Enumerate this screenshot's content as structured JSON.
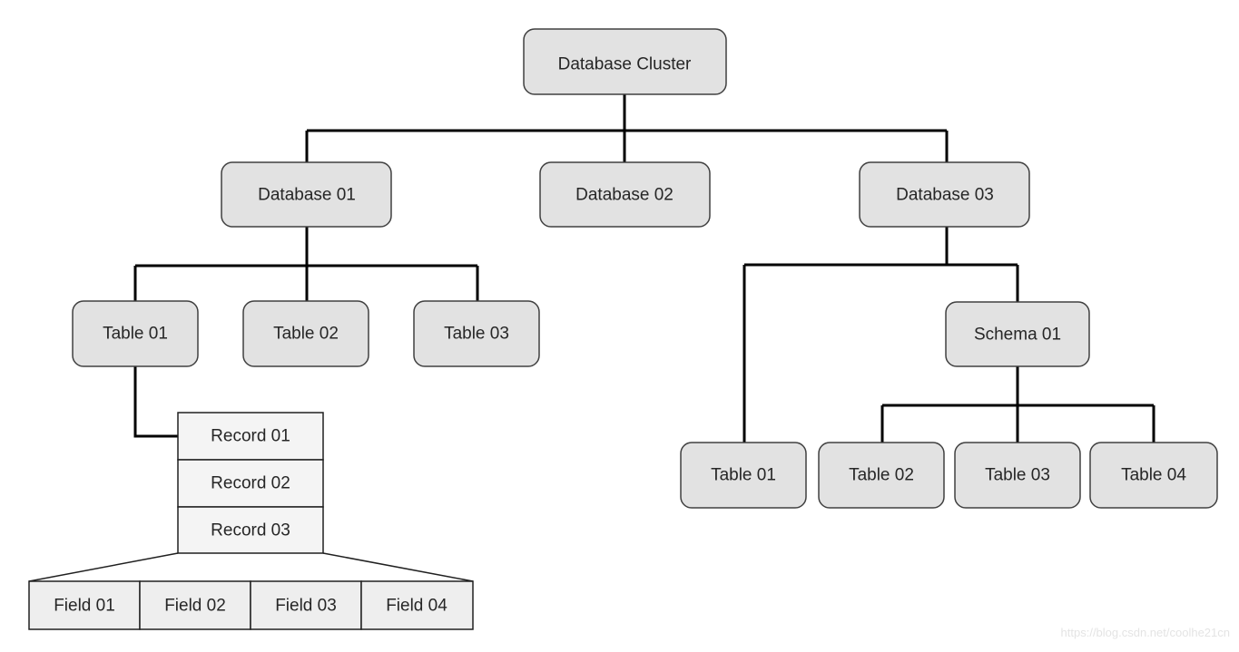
{
  "diagram": {
    "root": "Database Cluster",
    "databases": [
      "Database 01",
      "Database 02",
      "Database 03"
    ],
    "db01_tables": [
      "Table 01",
      "Table 02",
      "Table 03"
    ],
    "records": [
      "Record 01",
      "Record 02",
      "Record 03"
    ],
    "fields": [
      "Field 01",
      "Field 02",
      "Field 03",
      "Field 04"
    ],
    "db03_table": "Table 01",
    "schema": "Schema 01",
    "schema_tables": [
      "Table 02",
      "Table 03",
      "Table 04"
    ]
  },
  "watermark": "https://blog.csdn.net/coolhe21cn"
}
